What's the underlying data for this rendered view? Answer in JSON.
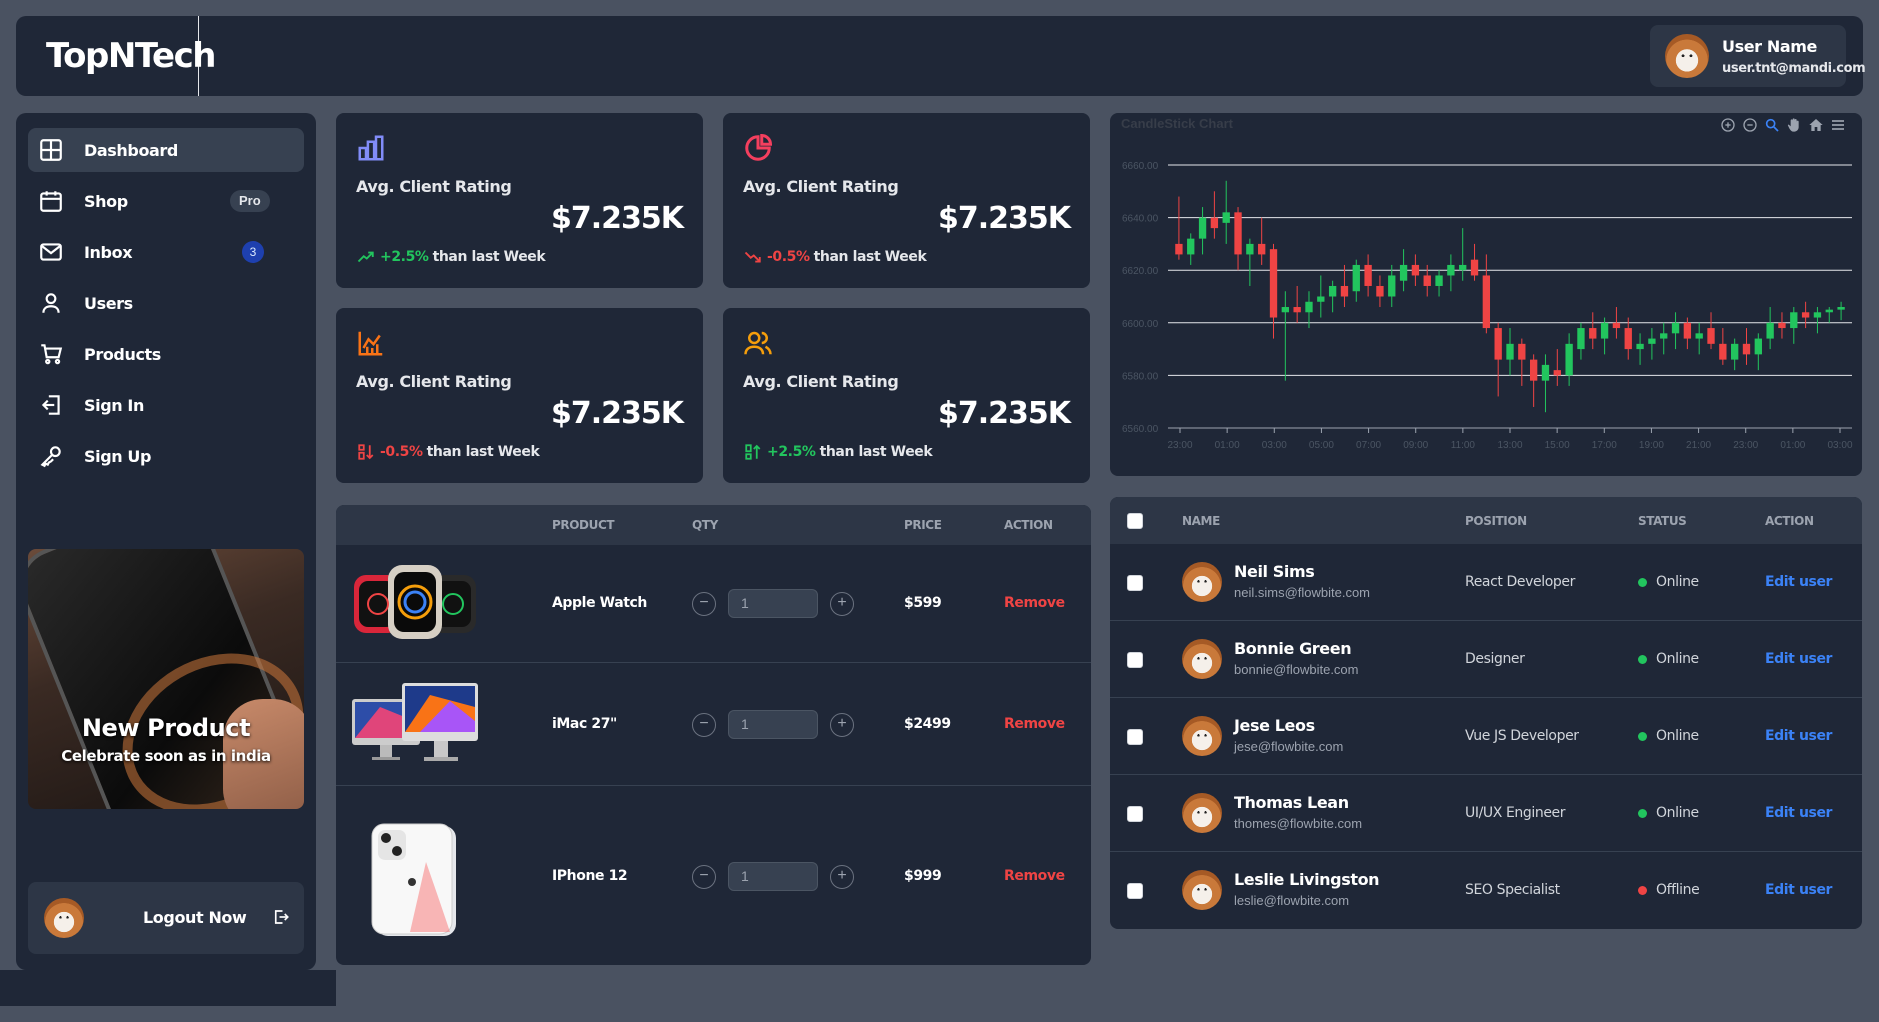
{
  "header": {
    "logo": "TopNTech",
    "user_name": "User Name",
    "user_email": "user.tnt@mandi.com"
  },
  "sidebar": {
    "items": [
      {
        "label": "Dashboard",
        "icon": "dashboard-grid-icon",
        "active": true
      },
      {
        "label": "Shop",
        "icon": "calendar-shop-icon",
        "badge": "Pro"
      },
      {
        "label": "Inbox",
        "icon": "mail-icon",
        "badge": "3"
      },
      {
        "label": "Users",
        "icon": "user-icon"
      },
      {
        "label": "Products",
        "icon": "cart-icon"
      },
      {
        "label": "Sign In",
        "icon": "sign-in-icon"
      },
      {
        "label": "Sign Up",
        "icon": "key-icon"
      }
    ],
    "promo": {
      "title": "New Product",
      "subtitle": "Celebrate soon as in india"
    },
    "logout_label": "Logout Now"
  },
  "stats": [
    {
      "title": "Avg. Client Rating",
      "value": "$7.235K",
      "change": "+2.5%",
      "suffix": "than last Week",
      "trend": "up",
      "icon": "bar-chart-icon",
      "icon_color": "#818cf8"
    },
    {
      "title": "Avg. Client Rating",
      "value": "$7.235K",
      "change": "-0.5%",
      "suffix": "than last Week",
      "trend": "down",
      "icon": "pie-chart-icon",
      "icon_color": "#f43f5e"
    },
    {
      "title": "Avg. Client Rating",
      "value": "$7.235K",
      "change": "-0.5%",
      "suffix": "than last Week",
      "trend": "down",
      "icon": "line-chart-icon",
      "icon_color": "#f97316"
    },
    {
      "title": "Avg. Client Rating",
      "value": "$7.235K",
      "change": "+2.5%",
      "suffix": "than last Week",
      "trend": "up",
      "icon": "users-icon",
      "icon_color": "#f59e0b"
    }
  ],
  "products": {
    "columns": [
      "PRODUCT",
      "QTY",
      "PRICE",
      "ACTION"
    ],
    "rows": [
      {
        "name": "Apple Watch",
        "qty": "1",
        "price": "$599",
        "action": "Remove"
      },
      {
        "name": "iMac 27\"",
        "qty": "1",
        "price": "$2499",
        "action": "Remove"
      },
      {
        "name": "IPhone 12",
        "qty": "1",
        "price": "$999",
        "action": "Remove"
      }
    ]
  },
  "chart_data": {
    "type": "candlestick",
    "title": "CandleStick Chart",
    "y_ticks": [
      "6660.00",
      "6640.00",
      "6620.00",
      "6600.00",
      "6580.00",
      "6560.00"
    ],
    "ylim": [
      6560,
      6660
    ],
    "x_ticks": [
      "23:00",
      "01:00",
      "03:00",
      "05:00",
      "07:00",
      "09:00",
      "11:00",
      "13:00",
      "15:00",
      "17:00",
      "19:00",
      "21:00",
      "23:00",
      "01:00",
      "03:00"
    ],
    "ohlc": [
      [
        6630,
        6648,
        6624,
        6626
      ],
      [
        6626,
        6634,
        6622,
        6632
      ],
      [
        6632,
        6644,
        6626,
        6640
      ],
      [
        6640,
        6650,
        6632,
        6636
      ],
      [
        6638,
        6654,
        6630,
        6642
      ],
      [
        6642,
        6644,
        6620,
        6626
      ],
      [
        6626,
        6632,
        6614,
        6630
      ],
      [
        6630,
        6640,
        6622,
        6626
      ],
      [
        6628,
        6630,
        6594,
        6602
      ],
      [
        6604,
        6612,
        6578,
        6606
      ],
      [
        6606,
        6614,
        6600,
        6604
      ],
      [
        6604,
        6612,
        6598,
        6608
      ],
      [
        6608,
        6618,
        6602,
        6610
      ],
      [
        6610,
        6616,
        6604,
        6614
      ],
      [
        6614,
        6622,
        6606,
        6610
      ],
      [
        6612,
        6624,
        6608,
        6622
      ],
      [
        6622,
        6626,
        6610,
        6614
      ],
      [
        6614,
        6618,
        6606,
        6610
      ],
      [
        6610,
        6622,
        6606,
        6618
      ],
      [
        6616,
        6628,
        6612,
        6622
      ],
      [
        6622,
        6626,
        6614,
        6618
      ],
      [
        6618,
        6622,
        6610,
        6614
      ],
      [
        6614,
        6620,
        6610,
        6618
      ],
      [
        6618,
        6626,
        6612,
        6622
      ],
      [
        6620,
        6636,
        6616,
        6622
      ],
      [
        6624,
        6630,
        6616,
        6618
      ],
      [
        6618,
        6626,
        6596,
        6598
      ],
      [
        6598,
        6600,
        6572,
        6586
      ],
      [
        6586,
        6598,
        6580,
        6592
      ],
      [
        6592,
        6594,
        6576,
        6586
      ],
      [
        6586,
        6588,
        6568,
        6578
      ],
      [
        6578,
        6588,
        6566,
        6584
      ],
      [
        6582,
        6590,
        6576,
        6580
      ],
      [
        6580,
        6596,
        6576,
        6592
      ],
      [
        6590,
        6600,
        6586,
        6598
      ],
      [
        6598,
        6604,
        6590,
        6594
      ],
      [
        6594,
        6602,
        6588,
        6600
      ],
      [
        6600,
        6606,
        6594,
        6598
      ],
      [
        6598,
        6602,
        6586,
        6590
      ],
      [
        6590,
        6596,
        6584,
        6592
      ],
      [
        6592,
        6598,
        6586,
        6594
      ],
      [
        6594,
        6600,
        6588,
        6596
      ],
      [
        6596,
        6604,
        6590,
        6600
      ],
      [
        6600,
        6602,
        6590,
        6594
      ],
      [
        6594,
        6600,
        6588,
        6596
      ],
      [
        6598,
        6604,
        6590,
        6592
      ],
      [
        6592,
        6598,
        6584,
        6586
      ],
      [
        6586,
        6594,
        6582,
        6592
      ],
      [
        6592,
        6598,
        6584,
        6588
      ],
      [
        6588,
        6596,
        6582,
        6594
      ],
      [
        6594,
        6606,
        6590,
        6600
      ],
      [
        6600,
        6604,
        6594,
        6598
      ],
      [
        6598,
        6606,
        6592,
        6604
      ],
      [
        6604,
        6608,
        6598,
        6602
      ],
      [
        6602,
        6606,
        6596,
        6604
      ],
      [
        6604,
        6606,
        6600,
        6605
      ],
      [
        6605,
        6608,
        6601,
        6606
      ]
    ]
  },
  "users": {
    "columns": [
      "NAME",
      "POSITION",
      "STATUS",
      "ACTION"
    ],
    "rows": [
      {
        "name": "Neil Sims",
        "email": "neil.sims@flowbite.com",
        "position": "React Developer",
        "status": "Online",
        "action": "Edit user"
      },
      {
        "name": "Bonnie Green",
        "email": "bonnie@flowbite.com",
        "position": "Designer",
        "status": "Online",
        "action": "Edit user"
      },
      {
        "name": "Jese Leos",
        "email": "jese@flowbite.com",
        "position": "Vue JS Developer",
        "status": "Online",
        "action": "Edit user"
      },
      {
        "name": "Thomas Lean",
        "email": "thomes@flowbite.com",
        "position": "UI/UX Engineer",
        "status": "Online",
        "action": "Edit user"
      },
      {
        "name": "Leslie Livingston",
        "email": "leslie@flowbite.com",
        "position": "SEO Specialist",
        "status": "Offline",
        "action": "Edit user"
      }
    ]
  },
  "colors": {
    "bg": "#4a5261",
    "panel": "#1f2737",
    "up": "#22c55e",
    "down": "#ef4444",
    "link": "#3b82f6"
  }
}
